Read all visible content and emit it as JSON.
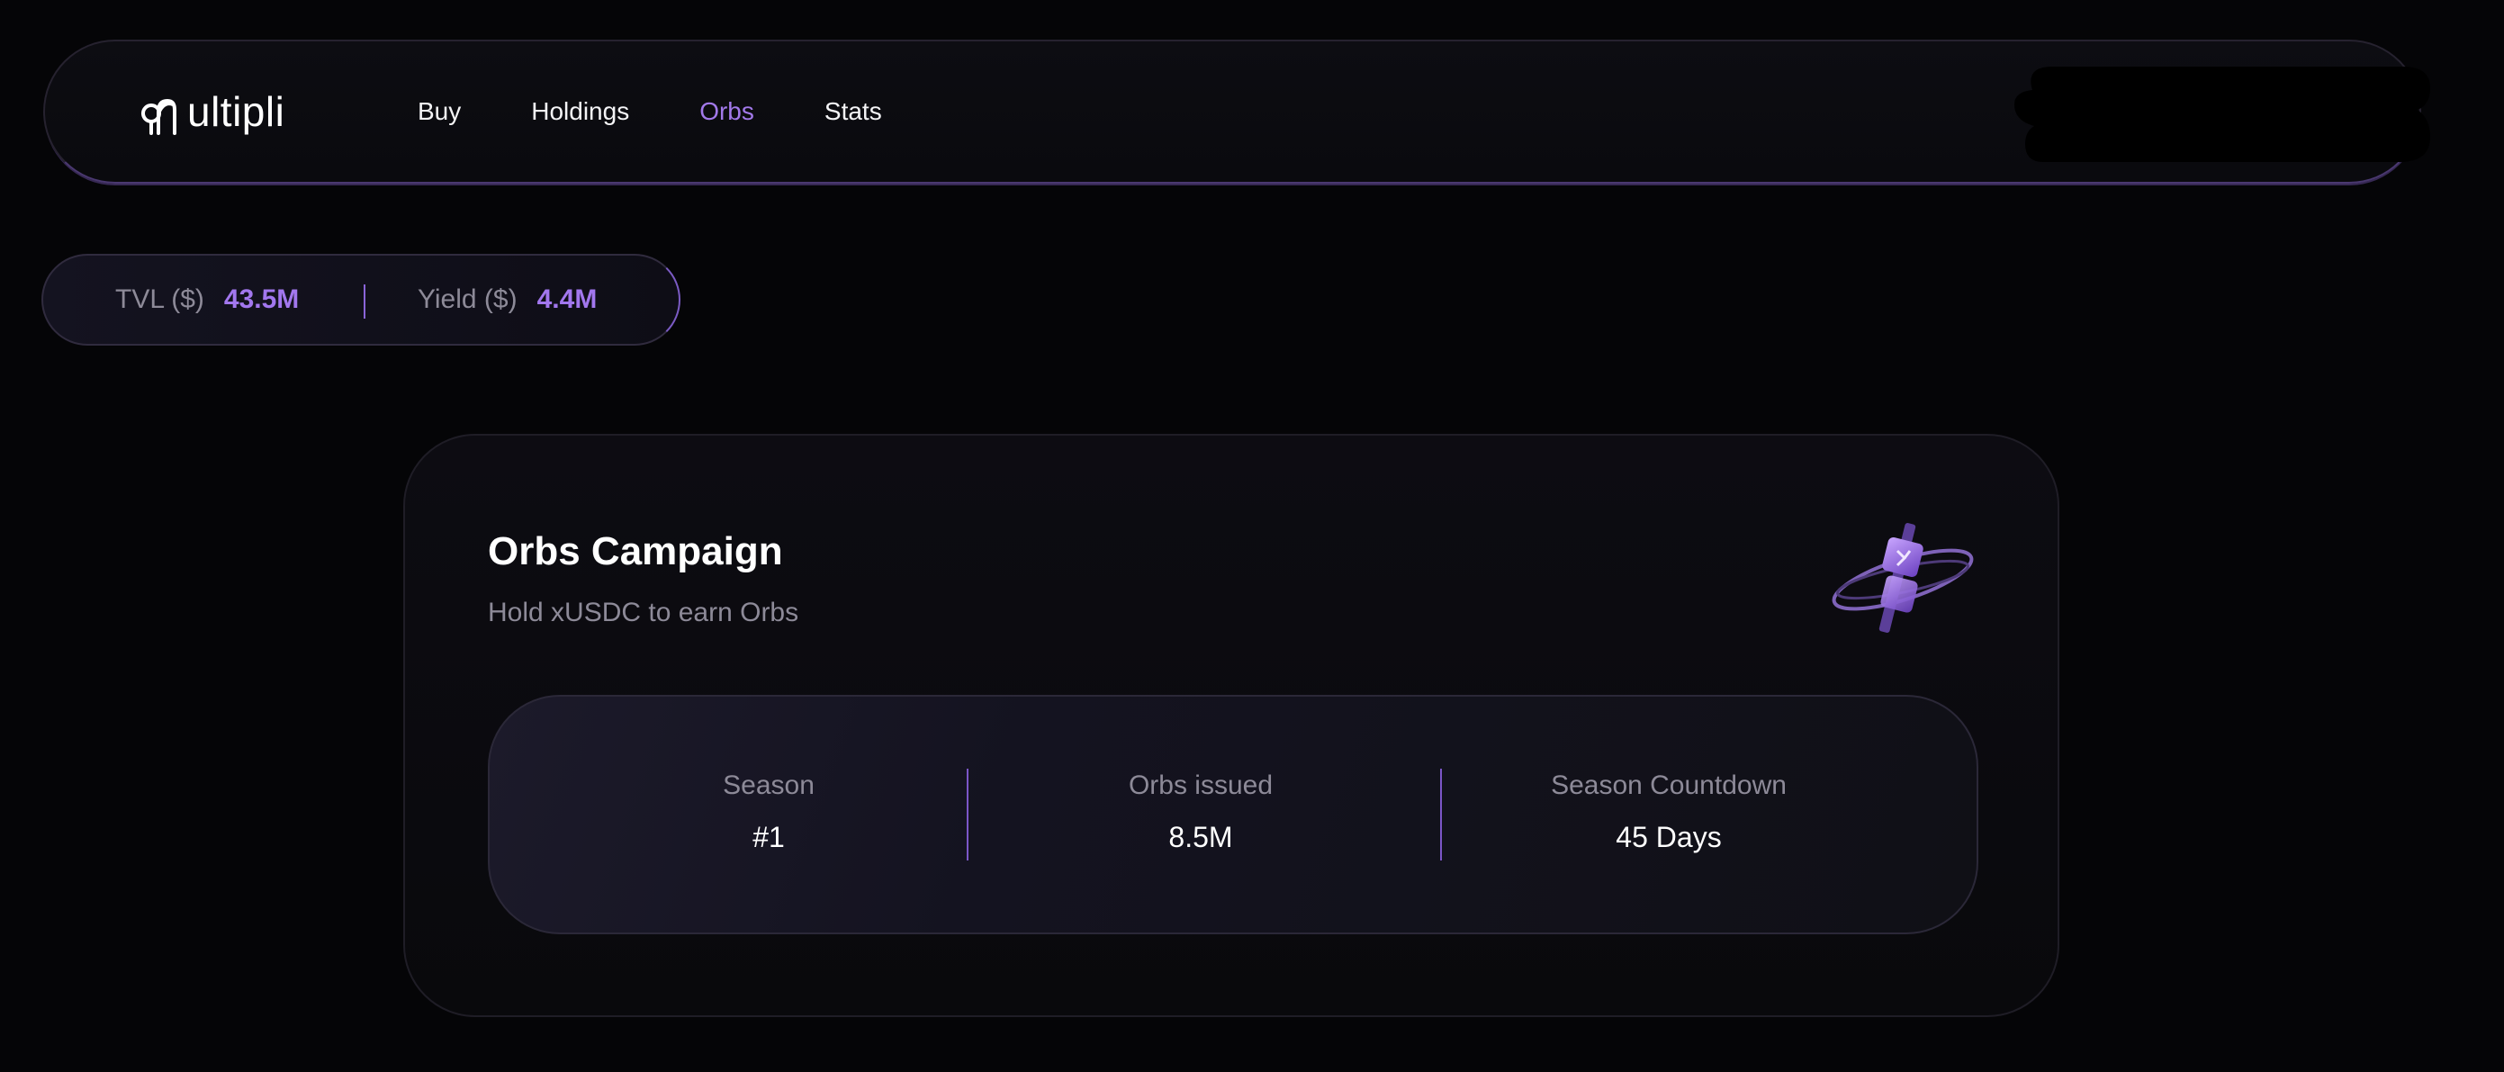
{
  "brand": {
    "name": "ultipli",
    "logo_icon": "multipli-logo-icon"
  },
  "nav": {
    "items": [
      {
        "label": "Buy",
        "active": false
      },
      {
        "label": "Holdings",
        "active": false
      },
      {
        "label": "Orbs",
        "active": true
      },
      {
        "label": "Stats",
        "active": false
      }
    ]
  },
  "stats": {
    "tvl_label": "TVL ($)",
    "tvl_value": "43.5M",
    "yield_label": "Yield ($)",
    "yield_value": "4.4M"
  },
  "campaign": {
    "title": "Orbs Campaign",
    "subtitle": "Hold xUSDC to earn Orbs",
    "illustration_icon": "orb-illustration-icon",
    "metrics": [
      {
        "label": "Season",
        "value": "#1"
      },
      {
        "label": "Orbs issued",
        "value": "8.5M"
      },
      {
        "label": "Season Countdown",
        "value": "45 Days"
      }
    ]
  },
  "colors": {
    "accent": "#a279ea",
    "background": "#050507",
    "muted_text": "#8d8a98"
  }
}
